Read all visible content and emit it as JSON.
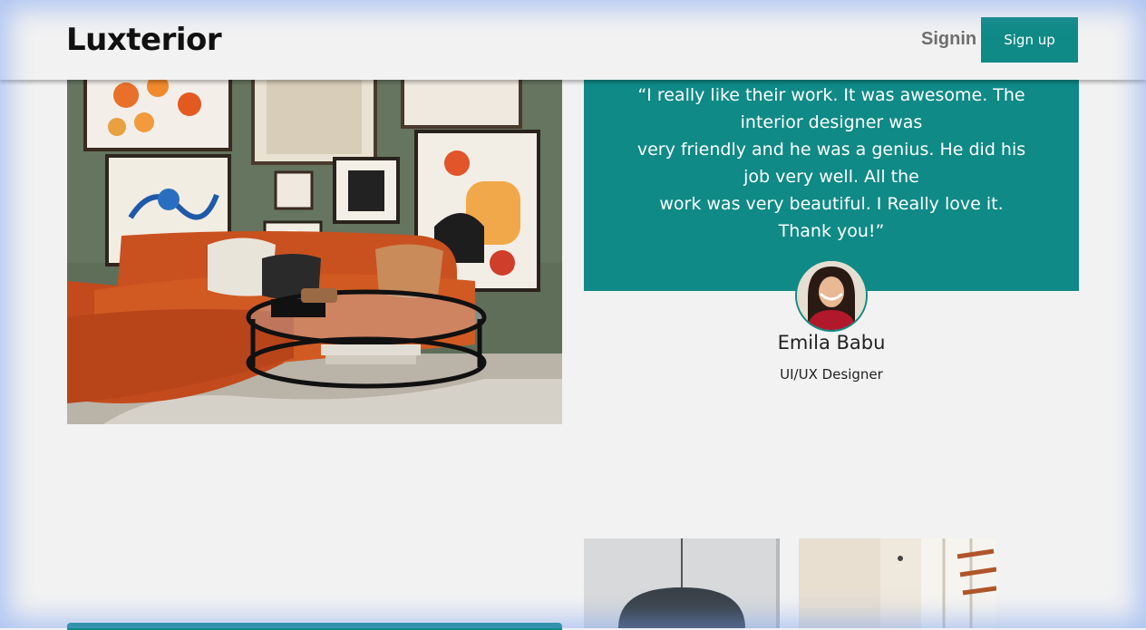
{
  "header": {
    "logo": "Luxterior",
    "signin_label": "Signin",
    "signup_label": "Sign up"
  },
  "testimonial": {
    "quote_lines": [
      "“I really like their work. It was awesome. The",
      "interior designer was",
      "very friendly and he was a genius. He did his",
      "job very well. All the",
      "work was very beautiful. I Really love it.",
      "Thank you!”"
    ],
    "name": "Emila Babu",
    "role": "UI/UX Designer"
  },
  "colors": {
    "accent": "#0f8a86",
    "background": "#f2f2f2",
    "text": "#222222",
    "muted": "#6f6f6f"
  }
}
